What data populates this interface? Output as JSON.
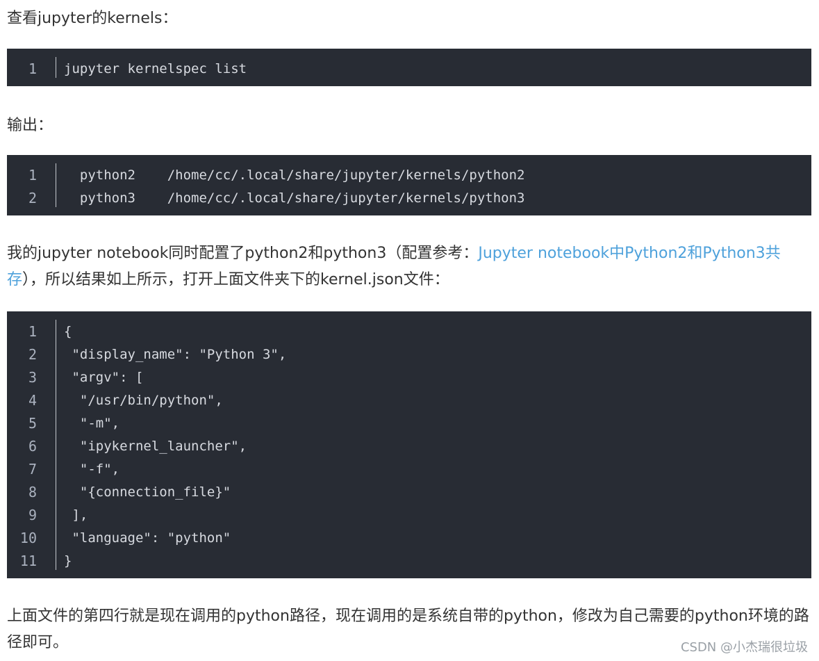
{
  "paragraphs": {
    "p1": "查看jupyter的kernels：",
    "p2": "输出：",
    "p3_before": "我的jupyter notebook同时配置了python2和python3（配置参考：",
    "p3_link": "Jupyter notebook中Python2和Python3共存",
    "p3_after": "），所以结果如上所示，打开上面文件夹下的kernel.json文件：",
    "p4": "上面文件的第四行就是现在调用的python路径，现在调用的是系统自带的python，修改为自己需要的python环境的路径即可。"
  },
  "code_blocks": [
    {
      "lines": [
        {
          "n": "1",
          "code": "jupyter kernelspec list"
        }
      ]
    },
    {
      "lines": [
        {
          "n": "1",
          "code": "  python2    /home/cc/.local/share/jupyter/kernels/python2"
        },
        {
          "n": "2",
          "code": "  python3    /home/cc/.local/share/jupyter/kernels/python3"
        }
      ]
    },
    {
      "lines": [
        {
          "n": "1",
          "code": "{"
        },
        {
          "n": "2",
          "code": " \"display_name\": \"Python 3\","
        },
        {
          "n": "3",
          "code": " \"argv\": ["
        },
        {
          "n": "4",
          "code": "  \"/usr/bin/python\","
        },
        {
          "n": "5",
          "code": "  \"-m\","
        },
        {
          "n": "6",
          "code": "  \"ipykernel_launcher\","
        },
        {
          "n": "7",
          "code": "  \"-f\","
        },
        {
          "n": "8",
          "code": "  \"{connection_file}\""
        },
        {
          "n": "9",
          "code": " ],"
        },
        {
          "n": "10",
          "code": " \"language\": \"python\""
        },
        {
          "n": "11",
          "code": "}"
        }
      ]
    }
  ],
  "watermark": "CSDN @小杰瑞很垃圾",
  "colors": {
    "code_bg": "#282c34",
    "link": "#4ea1db",
    "text": "#333333"
  }
}
